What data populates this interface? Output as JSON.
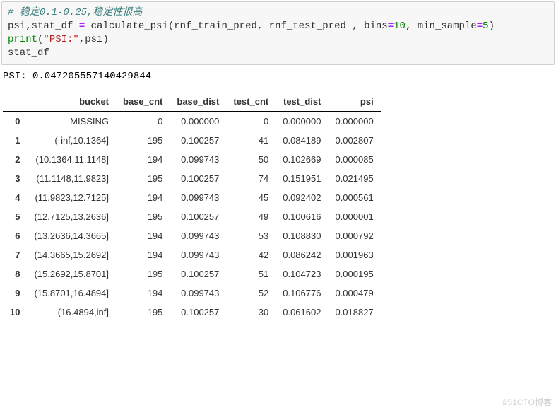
{
  "code": {
    "comment": "# 稳定0.1-0.25,稳定性很高",
    "line2_a": "psi,stat_df ",
    "line2_eq": "=",
    "line2_b": " calculate_psi(rnf_train_pred, rnf_test_pred , bins",
    "line2_eq2": "=",
    "line2_n1": "10",
    "line2_c": ", min_sample",
    "line2_eq3": "=",
    "line2_n2": "5",
    "line2_d": ")",
    "line3_print": "print",
    "line3_open": "(",
    "line3_str": "\"PSI:\"",
    "line3_rest": ",psi)",
    "line4": "stat_df"
  },
  "output_header": "PSI: 0.047205557140429844",
  "columns": [
    "bucket",
    "base_cnt",
    "base_dist",
    "test_cnt",
    "test_dist",
    "psi"
  ],
  "rows": [
    {
      "idx": "0",
      "bucket": "MISSING",
      "base_cnt": "0",
      "base_dist": "0.000000",
      "test_cnt": "0",
      "test_dist": "0.000000",
      "psi": "0.000000"
    },
    {
      "idx": "1",
      "bucket": "(-inf,10.1364]",
      "base_cnt": "195",
      "base_dist": "0.100257",
      "test_cnt": "41",
      "test_dist": "0.084189",
      "psi": "0.002807"
    },
    {
      "idx": "2",
      "bucket": "(10.1364,11.1148]",
      "base_cnt": "194",
      "base_dist": "0.099743",
      "test_cnt": "50",
      "test_dist": "0.102669",
      "psi": "0.000085"
    },
    {
      "idx": "3",
      "bucket": "(11.1148,11.9823]",
      "base_cnt": "195",
      "base_dist": "0.100257",
      "test_cnt": "74",
      "test_dist": "0.151951",
      "psi": "0.021495"
    },
    {
      "idx": "4",
      "bucket": "(11.9823,12.7125]",
      "base_cnt": "194",
      "base_dist": "0.099743",
      "test_cnt": "45",
      "test_dist": "0.092402",
      "psi": "0.000561"
    },
    {
      "idx": "5",
      "bucket": "(12.7125,13.2636]",
      "base_cnt": "195",
      "base_dist": "0.100257",
      "test_cnt": "49",
      "test_dist": "0.100616",
      "psi": "0.000001"
    },
    {
      "idx": "6",
      "bucket": "(13.2636,14.3665]",
      "base_cnt": "194",
      "base_dist": "0.099743",
      "test_cnt": "53",
      "test_dist": "0.108830",
      "psi": "0.000792"
    },
    {
      "idx": "7",
      "bucket": "(14.3665,15.2692]",
      "base_cnt": "194",
      "base_dist": "0.099743",
      "test_cnt": "42",
      "test_dist": "0.086242",
      "psi": "0.001963"
    },
    {
      "idx": "8",
      "bucket": "(15.2692,15.8701]",
      "base_cnt": "195",
      "base_dist": "0.100257",
      "test_cnt": "51",
      "test_dist": "0.104723",
      "psi": "0.000195"
    },
    {
      "idx": "9",
      "bucket": "(15.8701,16.4894]",
      "base_cnt": "194",
      "base_dist": "0.099743",
      "test_cnt": "52",
      "test_dist": "0.106776",
      "psi": "0.000479"
    },
    {
      "idx": "10",
      "bucket": "(16.4894,inf]",
      "base_cnt": "195",
      "base_dist": "0.100257",
      "test_cnt": "30",
      "test_dist": "0.061602",
      "psi": "0.018827"
    }
  ],
  "watermark": "©51CTO博客"
}
